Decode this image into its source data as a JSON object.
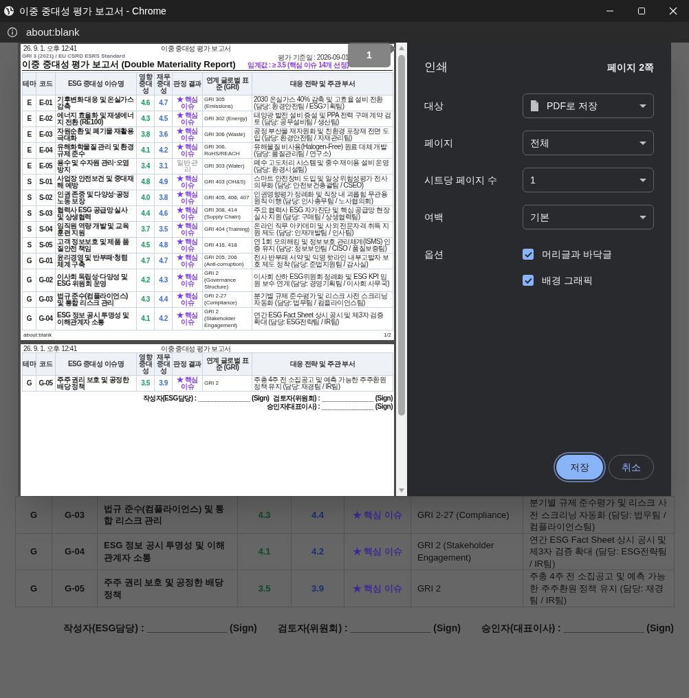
{
  "window": {
    "title": "이중 중대성 평가 보고서 - Chrome",
    "address": "about:blank"
  },
  "background_page": {
    "rows": [
      {
        "theme": "G",
        "code": "G-03",
        "issue": "법규 준수(컴플라이언스) 및 통합 리스크 관리",
        "impact": "4.3",
        "financial": "4.4",
        "result": "★ 핵심 이슈",
        "core": true,
        "gri": "GRI 2-27 (Compliance)",
        "strategy": "분기별 규제 준수평가 및 리스크 사전 스크리닝 자동화 (담당: 법무팀 / 컴플라이언스팀)"
      },
      {
        "theme": "G",
        "code": "G-04",
        "issue": "ESG 정보 공시 투명성 및 이해관계자 소통",
        "impact": "4.1",
        "financial": "4.2",
        "result": "★ 핵심 이슈",
        "core": true,
        "gri": "GRI 2 (Stakeholder Engagement)",
        "strategy": "연간 ESG Fact Sheet 상시 공시 및 제3자 검증 확대 (담당: ESG전략팀 / IR팀)"
      },
      {
        "theme": "G",
        "code": "G-05",
        "issue": "주주 권리 보호 및 공정한 배당 정책",
        "impact": "3.5",
        "financial": "3.9",
        "result": "★ 핵심 이슈",
        "core": true,
        "gri": "GRI 2",
        "strategy": "주총 4주 전 소집공고 및 예측 가능한 주주환원 정책 유지 (담당: 재경팀 / IR팀)"
      }
    ],
    "signatures": [
      "작성자(ESG담당) : _______________ (Sign)",
      "검토자(위원회) : _______________ (Sign)",
      "승인자(대표이사) : _______________ (Sign)"
    ]
  },
  "print_preview": {
    "page_badge": "1",
    "pages": [
      {
        "header_date": "26. 9. 1. 오후 12:41",
        "header_title": "이중 중대성 평가 보고서",
        "subtitle": "GRI 3 (2021) / EU CSRD ESRS Standard",
        "title": "이중 중대성 평가 보고서 (Double Materiality Report)",
        "base_date": "평가 기준일 : 2026-09-01",
        "threshold": "임계값 : ≥ 3.5 (핵심 이슈 14개 선정)",
        "columns": [
          "테마",
          "코드",
          "ESG 중대성 이슈명",
          "영향 중대성",
          "재무 중대성",
          "판정 결과",
          "연계 글로벌 표준 (GRI)",
          "대응 전략 및 주관 부서"
        ],
        "rows": [
          {
            "theme": "E",
            "code": "E-01",
            "issue": "기후변화 대응 및 온실가스 감축",
            "impact": "4.6",
            "financial": "4.7",
            "result": "★ 핵심 이슈",
            "core": true,
            "gri": "GRI 305 (Emissions)",
            "strategy": "2030 온실가스 40% 감축 및 고효율 설비 전환 (담당: 환경안전팀 / ESG기획팀)"
          },
          {
            "theme": "E",
            "code": "E-02",
            "issue": "에너지 효율화 및 재생에너지 전환 (RE100)",
            "impact": "4.3",
            "financial": "4.5",
            "result": "★ 핵심 이슈",
            "core": true,
            "gri": "GRI 302 (Energy)",
            "strategy": "태양광 발전 설비 증설 및 PPA 전력 구매 계약 검토 (담당: 공무설비팀 / 생산팀)"
          },
          {
            "theme": "E",
            "code": "E-03",
            "issue": "자원순환 및 폐기물 재활용 극대화",
            "impact": "3.8",
            "financial": "3.6",
            "result": "★ 핵심 이슈",
            "core": true,
            "gri": "GRI 306 (Waste)",
            "strategy": "공정 부산물 재자원화 및 친환경 포장재 전면 도입 (담당: 환경안전팀 / 자재관리팀)"
          },
          {
            "theme": "E",
            "code": "E-04",
            "issue": "유해화학물질 관리 및 환경 규제 준수",
            "impact": "4.1",
            "financial": "4.2",
            "result": "★ 핵심 이슈",
            "core": true,
            "gri": "GRI 306, RoHS/REACH",
            "strategy": "유해물질 비사용(Halogen-Free) 원료 대체 개발 (담당: 품질관리팀 / 연구소)"
          },
          {
            "theme": "E",
            "code": "E-05",
            "issue": "용수 및 수자원 관리·오염 방지",
            "impact": "3.4",
            "financial": "3.1",
            "result": "일반 관리",
            "core": false,
            "gri": "GRI 303 (Water)",
            "strategy": "폐수 고도처리 시스템 및 중수 재이용 설비 운영 (담당: 환경시설팀)"
          },
          {
            "theme": "S",
            "code": "S-01",
            "issue": "사업장 안전보건 및 중대재해 예방",
            "impact": "4.8",
            "financial": "4.9",
            "result": "★ 핵심 이슈",
            "core": true,
            "gri": "GRI 403 (OH&S)",
            "strategy": "스마트 안전장비 도입 및 일상 위험성평가 전사 의무화 (담당: 안전보건총괄팀 / CSEO)"
          },
          {
            "theme": "S",
            "code": "S-02",
            "issue": "인권 존중 및 다양성·공정 노동 보장",
            "impact": "4.0",
            "financial": "3.8",
            "result": "★ 핵심 이슈",
            "core": true,
            "gri": "GRI 405, 406, 407",
            "strategy": "인권영향평가 정례화 및 직장 내 괴롭힘 무관용 원칙 이행 (담당: 인사총무팀 / 노사협의회)"
          },
          {
            "theme": "S",
            "code": "S-03",
            "issue": "협력사 ESG 공급망 실사 및 상생협력",
            "impact": "4.4",
            "financial": "4.6",
            "result": "★ 핵심 이슈",
            "core": true,
            "gri": "GRI 308, 414 (Supply Chain)",
            "strategy": "주요 협력사 ESG 자가진단 및 핵심 공급망 현장 실사 지원 (담당: 구매팀 / 상생협력팀)"
          },
          {
            "theme": "S",
            "code": "S-04",
            "issue": "임직원 역량 개발 및 교육훈련 지원",
            "impact": "3.7",
            "financial": "3.5",
            "result": "★ 핵심 이슈",
            "core": true,
            "gri": "GRI 404 (Training)",
            "strategy": "온라인 직무 아카데미 및 사외 전문자격 취득 지원 제도 (담당: 인재개발팀 / 인사팀)"
          },
          {
            "theme": "S",
            "code": "S-05",
            "issue": "고객 정보보호 및 제품 품질안전 책임",
            "impact": "4.5",
            "financial": "4.8",
            "result": "★ 핵심 이슈",
            "core": true,
            "gri": "GRI 416, 418",
            "strategy": "연 1회 모의해킹 및 정보보호 관리체계(ISMS) 인증 유지 (담당: 정보보안팀 / CISO / 품질보증팀)"
          },
          {
            "theme": "G",
            "code": "G-01",
            "issue": "윤리경영 및 반부패·청렴 체계 구축",
            "impact": "4.7",
            "financial": "4.7",
            "result": "★ 핵심 이슈",
            "core": true,
            "gri": "GRI 205, 206 (Anti-corruption)",
            "strategy": "전사 반부패 서약 및 익명 핫라인 내부고발자 보호 제도 정착 (담당: 준법지원팀 / 감사실)"
          },
          {
            "theme": "G",
            "code": "G-02",
            "issue": "이사회 독립성·다양성 및 ESG 위원회 운영",
            "impact": "4.2",
            "financial": "4.3",
            "result": "★ 핵심 이슈",
            "core": true,
            "gri": "GRI 2 (Governance Structure)",
            "strategy": "이사회 산하 ESG위원회 정례화 및 ESG KPI 임원 보수 연계 (담당: 경영기획팀 / 이사회 사무국)"
          },
          {
            "theme": "G",
            "code": "G-03",
            "issue": "법규 준수(컴플라이언스) 및 통합 리스크 관리",
            "impact": "4.3",
            "financial": "4.4",
            "result": "★ 핵심 이슈",
            "core": true,
            "gri": "GRI 2-27 (Compliance)",
            "strategy": "분기별 규제 준수평가 및 리스크 사전 스크리닝 자동화 (담당: 법무팀 / 컴플라이언스팀)"
          },
          {
            "theme": "G",
            "code": "G-04",
            "issue": "ESG 정보 공시 투명성 및 이해관계자 소통",
            "impact": "4.1",
            "financial": "4.2",
            "result": "★ 핵심 이슈",
            "core": true,
            "gri": "GRI 2 (Stakeholder Engagement)",
            "strategy": "연간 ESG Fact Sheet 상시 공시 및 제3자 검증 확대 (담당: ESG전략팀 / IR팀)"
          }
        ],
        "footer_url": "about:blank",
        "footer_page": "1/2"
      },
      {
        "header_date": "26. 9. 1. 오후 12:41",
        "header_title": "이중 중대성 평가 보고서",
        "columns": [
          "테마",
          "코드",
          "ESG 중대성 이슈명",
          "영향 중대성",
          "재무 중대성",
          "판정 결과",
          "연계 글로벌 표준 (GRI)",
          "대응 전략 및 주관 부서"
        ],
        "rows": [
          {
            "theme": "G",
            "code": "G-05",
            "issue": "주주 권리 보호 및 공정한 배당 정책",
            "impact": "3.5",
            "financial": "3.9",
            "result": "★ 핵심 이슈",
            "core": true,
            "gri": "GRI 2",
            "strategy": "주총 4주 전 소집공고 및 예측 가능한 주주환원 정책 유지 (담당: 재경팀 / IR팀)"
          }
        ],
        "signatures": [
          "작성자(ESG담당) : _______________ (Sign)",
          "검토자(위원회) : _______________ (Sign)",
          "승인자(대표이사) : _______________ (Sign)"
        ]
      }
    ]
  },
  "print_settings": {
    "title": "인쇄",
    "page_count": "페이지 2쪽",
    "fields": [
      {
        "label": "대상",
        "value": "PDF로 저장",
        "kind": "file"
      },
      {
        "label": "페이지",
        "value": "전체",
        "kind": "plain"
      },
      {
        "label": "시트당 페이지 수",
        "value": "1",
        "kind": "plain"
      },
      {
        "label": "여백",
        "value": "기본",
        "kind": "plain"
      }
    ],
    "options_label": "옵션",
    "options": [
      {
        "label": "머리글과 바닥글",
        "checked": true
      },
      {
        "label": "배경 그래픽",
        "checked": true
      }
    ],
    "buttons": [
      {
        "label": "저장",
        "kind": "primary"
      },
      {
        "label": "취소",
        "kind": "secondary"
      }
    ]
  }
}
